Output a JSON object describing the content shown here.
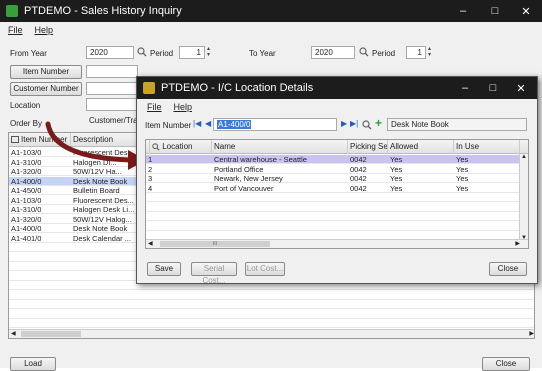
{
  "colors": {
    "titlebar": "#1c1c1c",
    "titlebar_icon": "#3a9e3a",
    "selection": "#c9c3f2",
    "selection_main": "#c6d3f5",
    "arrow": "#7a1b1b",
    "grid_line": "#e6e6e6",
    "link_blue": "#2a5cb8"
  },
  "main_window": {
    "title": "PTDEMO - Sales History Inquiry",
    "controls": [
      "–",
      "□",
      "✕"
    ],
    "menu": [
      "File",
      "Help"
    ],
    "from_year_label": "From Year",
    "from_year_value": "2020",
    "period_label": "Period",
    "period_value": "1",
    "to_year_label": "To Year",
    "to_year_value": "2020",
    "period2_label": "Period",
    "period2_value": "1",
    "item_number_button": "Item Number",
    "customer_number_button": "Customer Number",
    "location_label": "Location",
    "order_by_label": "Order By",
    "order_by_value": "Customer/Tran",
    "grid_headers": [
      "Item Number",
      "Description"
    ],
    "grid_rows": [
      [
        "A1-103/0",
        "Fluorescent Des..."
      ],
      [
        "A1-310/0",
        "Halogen Di..."
      ],
      [
        "A1-320/0",
        "50W/12V Ha..."
      ],
      [
        "A1-400/0",
        "Desk Note Book"
      ],
      [
        "A1-450/0",
        "Bulletin Board"
      ],
      [
        "A1-103/0",
        "Fluorescent Des..."
      ],
      [
        "A1-310/0",
        "Halogen Desk Li..."
      ],
      [
        "A1-320/0",
        "50W/12V Halog..."
      ],
      [
        "A1-400/0",
        "Desk Note Book"
      ],
      [
        "A1-401/0",
        "Desk Calendar ..."
      ]
    ],
    "selected_row": 3,
    "load_button": "Load",
    "close_button": "Close"
  },
  "dialog": {
    "title": "PTDEMO - I/C Location Details",
    "controls": [
      "–",
      "□",
      "✕"
    ],
    "menu": [
      "File",
      "Help"
    ],
    "item_number_label": "Item Number",
    "item_number_value": "A1-400/0",
    "item_description": "Desk Note Book",
    "nav_first": "|◀",
    "nav_prev": "◀",
    "nav_next": "▶",
    "nav_last": "▶|",
    "add_glyph": "+",
    "grid_headers": [
      "",
      "Location",
      "Name",
      "Picking Sequen...",
      "Allowed",
      "In Use"
    ],
    "grid_rows": [
      [
        "1",
        "Central warehouse - Seattle",
        "0042",
        "Yes",
        "Yes"
      ],
      [
        "2",
        "Portland Office",
        "0042",
        "Yes",
        "Yes"
      ],
      [
        "3",
        "Newark, New Jersey",
        "0042",
        "Yes",
        "Yes"
      ],
      [
        "4",
        "Port of Vancouver",
        "0042",
        "Yes",
        "Yes"
      ]
    ],
    "selected_row": 0,
    "scroll_glyph": "III",
    "save_button": "Save",
    "serial_cost_button": "Serial Cost...",
    "lot_cost_button": "Lot Cost...",
    "close_button": "Close"
  }
}
